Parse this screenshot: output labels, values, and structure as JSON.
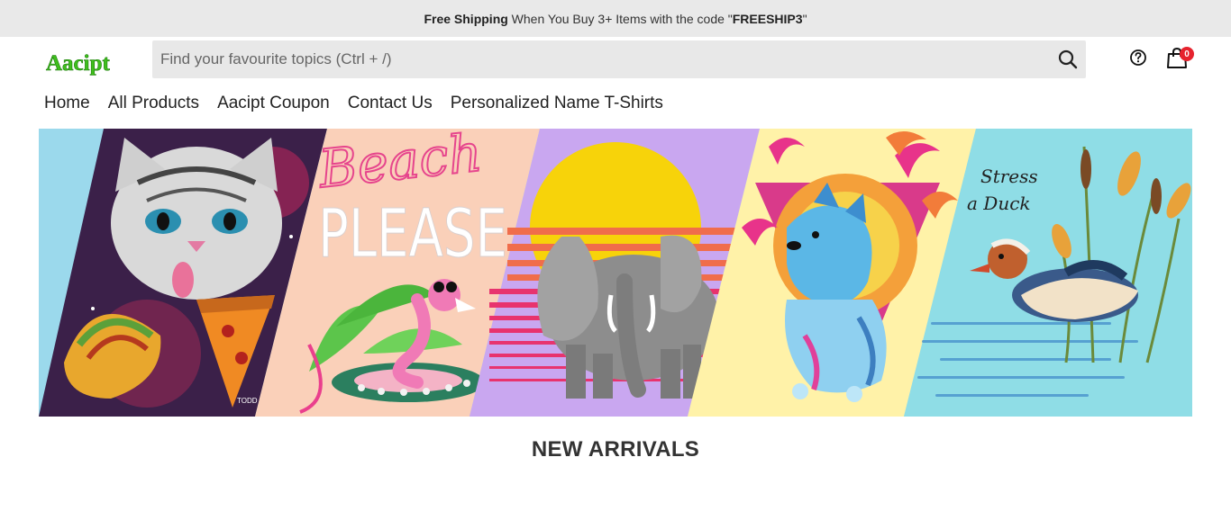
{
  "announcement": {
    "bold_lead": "Free Shipping",
    "middle": " When You Buy 3+ Items with the code \"",
    "code": "FREESHIP3",
    "end": "\""
  },
  "brand": {
    "logo_text": "Aacipt",
    "logo_color": "#3fbf1c"
  },
  "search": {
    "placeholder": "Find your favourite topics (Ctrl + /)",
    "value": ""
  },
  "header_icons": {
    "search": "search-icon",
    "help": "help-circle-icon",
    "cart": "shopping-bag-icon"
  },
  "cart": {
    "count": "0",
    "badge_color": "#e6232e"
  },
  "nav": {
    "items": [
      {
        "label": "Home"
      },
      {
        "label": "All Products"
      },
      {
        "label": "Aacipt Coupon"
      },
      {
        "label": "Contact Us"
      },
      {
        "label": "Personalized Name T-Shirts"
      }
    ]
  },
  "banner": {
    "panels": [
      {
        "name": "taco-cat",
        "signature": "TODD ART"
      },
      {
        "name": "beach-please",
        "script_text": "Beach",
        "block_text": "PLEASE"
      },
      {
        "name": "retro-elephant"
      },
      {
        "name": "vaporwave-dog"
      },
      {
        "name": "stress-duck",
        "text_line1": "Stress",
        "text_line2": "a Duck"
      }
    ]
  },
  "section": {
    "title": "NEW ARRIVALS"
  }
}
